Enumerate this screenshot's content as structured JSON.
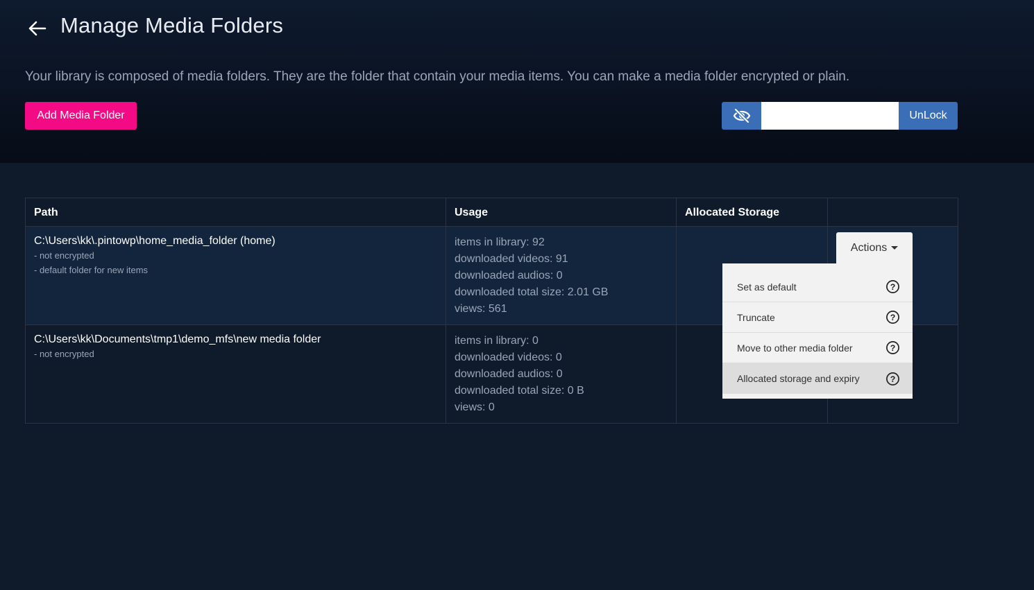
{
  "header": {
    "title": "Manage Media Folders",
    "description": "Your library is composed of media folders. They are the folder that contain your media items. You can make a media folder encrypted or plain.",
    "add_button_label": "Add Media Folder",
    "unlock": {
      "toggle_icon": "eye-slash-icon",
      "password_value": "",
      "button_label": "UnLock"
    }
  },
  "table": {
    "columns": [
      "Path",
      "Usage",
      "Allocated Storage",
      ""
    ],
    "rows": [
      {
        "path": "C:\\Users\\kk\\.pintowp\\home_media_folder (home)",
        "notes": [
          "- not encrypted",
          "- default folder for new items"
        ],
        "usage": [
          "items in library: 92",
          "downloaded videos: 91",
          "downloaded audios: 0",
          "downloaded total size: 2.01 GB",
          "views: 561"
        ],
        "allocated": ""
      },
      {
        "path": "C:\\Users\\kk\\Documents\\tmp1\\demo_mfs\\new media folder",
        "notes": [
          "- not encrypted"
        ],
        "usage": [
          "items in library: 0",
          "downloaded videos: 0",
          "downloaded audios: 0",
          "downloaded total size: 0 B",
          "views: 0"
        ],
        "allocated": ""
      }
    ]
  },
  "actions": {
    "button_label": "Actions",
    "menu": [
      {
        "label": "Set as default",
        "icon": "question-circle-icon"
      },
      {
        "label": "Truncate",
        "icon": "question-circle-icon"
      },
      {
        "label": "Move to other media folder",
        "icon": "question-circle-icon"
      },
      {
        "label": "Allocated storage and expiry",
        "icon": "question-circle-icon",
        "hovered": true
      }
    ]
  },
  "colors": {
    "accent_pink": "#f50a85",
    "primary_blue": "#3a6fb7",
    "background": "#0f1a2b",
    "row_highlight": "#13243d"
  }
}
